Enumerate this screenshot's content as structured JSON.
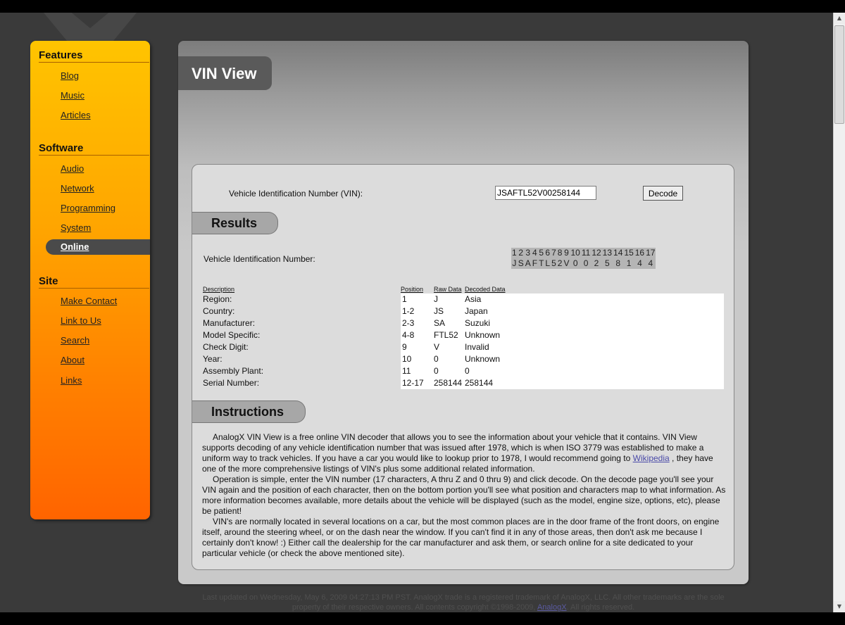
{
  "sidebar": {
    "features": {
      "title": "Features",
      "items": [
        "Blog",
        "Music",
        "Articles"
      ]
    },
    "software": {
      "title": "Software",
      "items": [
        "Audio",
        "Network",
        "Programming",
        "System"
      ],
      "active": "Online"
    },
    "site": {
      "title": "Site",
      "items": [
        "Make Contact",
        "Link to Us",
        "Search",
        "About",
        "Links"
      ]
    }
  },
  "page": {
    "title": "VIN View"
  },
  "form": {
    "label": "Vehicle Identification Number (VIN):",
    "value": "JSAFTL52V00258144",
    "button": "Decode"
  },
  "results": {
    "heading": "Results",
    "vin_label": "Vehicle Identification Number:",
    "positions": [
      "1",
      "2",
      "3",
      "4",
      "5",
      "6",
      "7",
      "8",
      "9",
      "10",
      "11",
      "12",
      "13",
      "14",
      "15",
      "16",
      "17"
    ],
    "chars": [
      "J",
      "S",
      "A",
      "F",
      "T",
      "L",
      "5",
      "2",
      "V",
      "0",
      "0",
      "2",
      "5",
      "8",
      "1",
      "4",
      "4"
    ],
    "headers": [
      "Description",
      "Position",
      "Raw Data",
      "Decoded Data"
    ],
    "rows": [
      {
        "desc": "Region:",
        "pos": "1",
        "raw": "J",
        "decoded": "Asia"
      },
      {
        "desc": "Country:",
        "pos": "1-2",
        "raw": "JS",
        "decoded": "Japan"
      },
      {
        "desc": "Manufacturer:",
        "pos": "2-3",
        "raw": "SA",
        "decoded": "Suzuki"
      },
      {
        "desc": "Model Specific:",
        "pos": "4-8",
        "raw": "FTL52",
        "decoded": "Unknown"
      },
      {
        "desc": "Check Digit:",
        "pos": "9",
        "raw": "V",
        "decoded": "Invalid"
      },
      {
        "desc": "Year:",
        "pos": "10",
        "raw": "0",
        "decoded": "Unknown"
      },
      {
        "desc": "Assembly Plant:",
        "pos": "11",
        "raw": "0",
        "decoded": "0"
      },
      {
        "desc": "Serial Number:",
        "pos": "12-17",
        "raw": "258144",
        "decoded": "258144"
      }
    ]
  },
  "instructions": {
    "heading": "Instructions",
    "p1_before": "AnalogX VIN View is a free online VIN decoder that allows you to see the information about your vehicle that it contains. VIN View supports decoding of any vehicle identification number that was issued after 1978, which is when ISO 3779 was established to make a uniform way to track vehicles. If you have a car you would like to lookup prior to 1978, I would recommend going to ",
    "p1_link": "Wikipedia",
    "p1_after": " , they have one of the more comprehensive listings of VIN's plus some additional related information.",
    "p2": "Operation is simple, enter the VIN number (17 characters, A thru Z and 0 thru 9) and click decode. On the decode page you'll see your VIN again and the position of each character, then on the bottom portion you'll see what position and characters map to what information. As more information becomes available, more details about the vehicle will be displayed (such as the model, engine size, options, etc), please be patient!",
    "p3": "VIN's are normally located in several locations on a car, but the most common places are in the door frame of the front doors, on engine itself, around the steering wheel, or on the dash near the window. If you can't find it in any of those areas, then don't ask me because I certainly don't know! :) Either call the dealership for the car manufacturer and ask them, or search online for a site dedicated to your particular vehicle (or check the above mentioned site)."
  },
  "footer": {
    "line1": "Last updated on Wednesday, May 6, 2009 04:27:13 PM PST. AnalogX trade is a registered trademark of AnalogX, LLC. All other trademarks are the sole",
    "line2_before": "property of their respective owners. All contents copyright ©1998-2009, ",
    "line2_link": "AnalogX",
    "line2_after": ". All rights reserved."
  },
  "colors": {
    "sidebar_top": "#ffc400",
    "sidebar_bottom": "#ff6400",
    "page_bg": "#3a3a3a",
    "link": "#4a4aa8"
  }
}
